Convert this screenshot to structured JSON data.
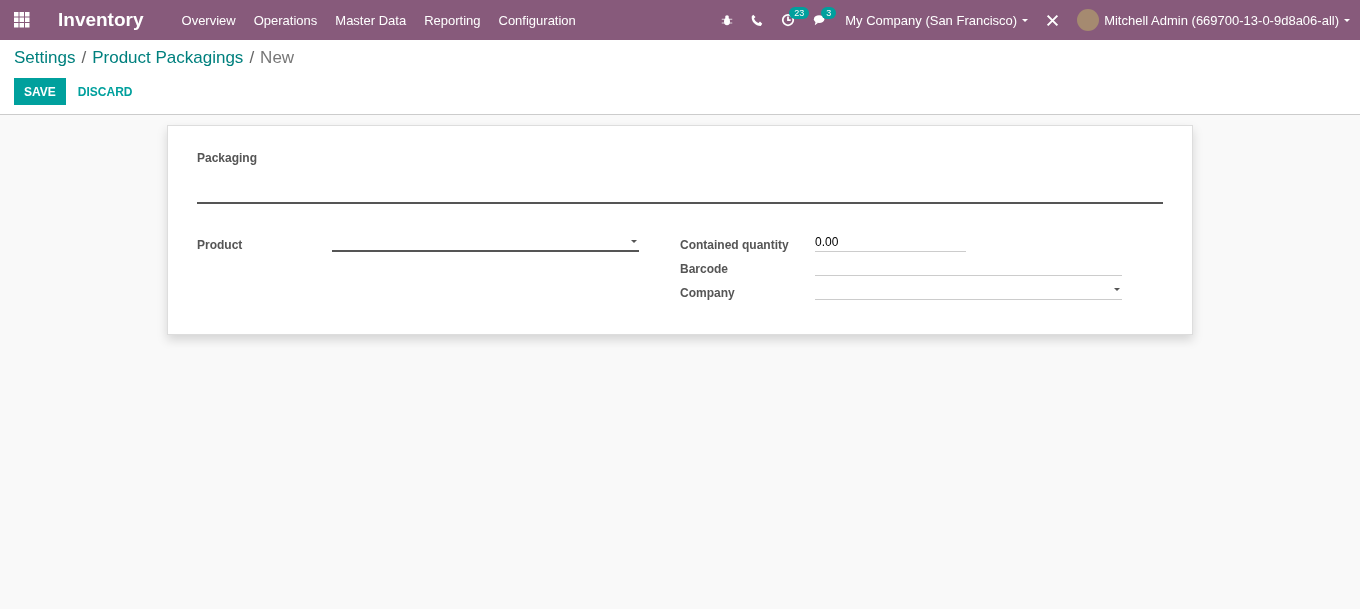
{
  "navbar": {
    "app_name": "Inventory",
    "menus": [
      "Overview",
      "Operations",
      "Master Data",
      "Reporting",
      "Configuration"
    ],
    "activity_count": "23",
    "message_count": "3",
    "company": "My Company (San Francisco)",
    "user": "Mitchell Admin (669700-13-0-9d8a06-all)"
  },
  "breadcrumbs": [
    {
      "label": "Settings",
      "current": false
    },
    {
      "separator": "/",
      "label": "Product Packagings",
      "current": false
    },
    {
      "separator": "/",
      "label": "New",
      "current": true
    }
  ],
  "buttons": {
    "save": "SAVE",
    "discard": "DISCARD"
  },
  "form": {
    "title_field": {
      "label": "Packaging",
      "required": true
    },
    "left_fields": [
      {
        "label": "Product",
        "kind": "select",
        "required": true
      }
    ],
    "right_fields": [
      {
        "label": "Contained quantity",
        "kind": "text",
        "required": false,
        "value": "0.00",
        "short": true
      },
      {
        "label": "Barcode",
        "kind": "text",
        "required": false,
        "short": false
      },
      {
        "label": "Company",
        "kind": "select",
        "required": false,
        "short": false
      }
    ]
  }
}
